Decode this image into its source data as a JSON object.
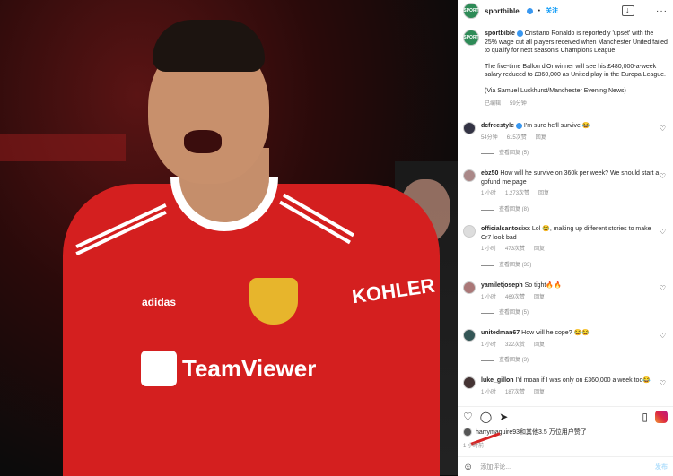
{
  "header": {
    "username": "sportbible",
    "follow_label": "关注",
    "more_label": "···"
  },
  "caption": {
    "username": "sportbible",
    "text1": "Cristiano Ronaldo is reportedly 'upset' with the 25% wage cut all players received when Manchester United failed to qualify for next season's Champions League.",
    "text2": "The five-time Ballon d'Or winner will see his £480,000-a-week salary reduced to £360,000 as United play in the Europa League.",
    "text3": "(Via Samuel Luckhurst/Manchester Evening News)",
    "edited": "已编辑",
    "time": "59分钟"
  },
  "comments": [
    {
      "username": "dcfreestyle",
      "text": "I'm sure he'll survive 😂",
      "time": "54分钟",
      "likes": "615次赞",
      "reply": "回复",
      "view_replies": "查看回复 (5)"
    },
    {
      "username": "ebz50",
      "text": "How will he survive on 360k per week? We should start a gofund me page",
      "time": "1 小时",
      "likes": "1,273次赞",
      "reply": "回复",
      "view_replies": "查看回复 (8)"
    },
    {
      "username": "officialsantosixx",
      "text": "Lol 😂, making up different stories to make Cr7 look bad",
      "time": "1 小时",
      "likes": "473次赞",
      "reply": "回复",
      "view_replies": "查看回复 (33)"
    },
    {
      "username": "yamiletjoseph",
      "text": "So tight🔥🔥",
      "time": "1 小时",
      "likes": "469次赞",
      "reply": "回复",
      "view_replies": "查看回复 (5)"
    },
    {
      "username": "unitedman67",
      "text": "How will he cope? 😂😂",
      "time": "1 小时",
      "likes": "322次赞",
      "reply": "回复",
      "view_replies": "查看回复 (3)"
    },
    {
      "username": "luke_gillon",
      "text": "I'd moan if I was only on £360,000 a week too😂",
      "time": "1 小时",
      "likes": "187次赞",
      "reply": "回复",
      "view_replies": ""
    }
  ],
  "likes_line": "harrymaguire93和其他3.5 万位用户赞了",
  "timeago": "1 小时前",
  "add_comment": {
    "placeholder": "添加评论...",
    "post_label": "发布"
  },
  "photo": {
    "sponsor": "TeamViewer",
    "kit_sponsor": "KOHLER",
    "brand": "adidas"
  }
}
